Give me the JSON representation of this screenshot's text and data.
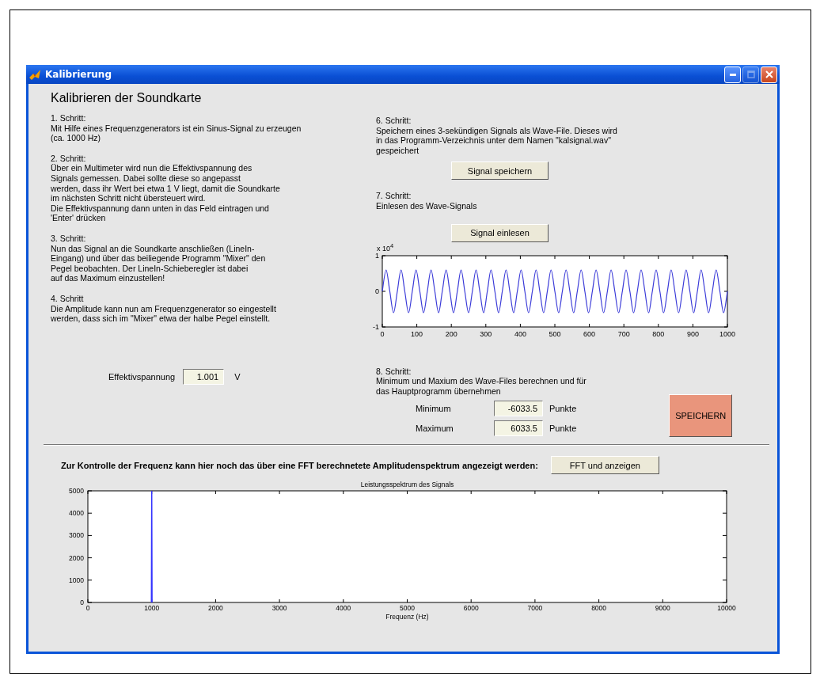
{
  "window": {
    "title": "Kalibrierung",
    "buttons": [
      {
        "kind": "minimize",
        "disabled": false
      },
      {
        "kind": "maximize",
        "disabled": true
      },
      {
        "kind": "close",
        "disabled": false
      }
    ]
  },
  "heading": "Kalibrieren der Soundkarte",
  "left_steps": [
    {
      "title": "1. Schritt:",
      "text": "Mit Hilfe eines Frequenzgenerators ist ein Sinus-Signal zu erzeugen\n(ca. 1000 Hz)"
    },
    {
      "title": "2. Schritt:",
      "text": "Über ein Multimeter wird nun die Effektivspannung des\nSignals gemessen. Dabei sollte diese so angepasst\nwerden, dass ihr Wert bei etwa 1 V liegt, damit die Soundkarte\nim nächsten Schritt nicht übersteuert wird.\nDie Effektivspannung dann unten in das Feld eintragen und\n'Enter' drücken"
    },
    {
      "title": "3. Schritt:",
      "text": "Nun das Signal an die Soundkarte anschließen (LineIn-\nEingang) und über das beiliegende Programm \"Mixer\" den\nPegel beobachten. Der LineIn-Schieberegler ist dabei\nauf das Maximum einzustellen!"
    },
    {
      "title": "4. Schritt",
      "text": "Die Amplitude kann nun am Frequenzgenerator so eingestellt\nwerden, dass sich im \"Mixer\" etwa der halbe Pegel einstellt."
    }
  ],
  "voltage": {
    "label": "Effektivspannung",
    "value": "1.001",
    "unit": "V"
  },
  "step6": {
    "title": "6. Schritt:",
    "text": "Speichern eines 3-sekündigen Signals als Wave-File. Dieses wird\nin das Programm-Verzeichnis unter dem Namen \"kalsignal.wav\"\ngespeichert",
    "button": "Signal speichern"
  },
  "step7": {
    "title": "7. Schritt:",
    "text": "Einlesen des Wave-Signals",
    "button": "Signal einlesen"
  },
  "signal_plot": {
    "exponent_label": "x 10$^{4}$",
    "chart_data": {
      "type": "line",
      "xlim": [
        0,
        1000
      ],
      "ylim": [
        -1,
        1
      ],
      "xticks": [
        0,
        100,
        200,
        300,
        400,
        500,
        600,
        700,
        800,
        900,
        1000
      ],
      "yticks": [
        -1,
        0,
        1
      ],
      "x": [
        0,
        10.9,
        21.7,
        32.6,
        43.5,
        54.3,
        65.2,
        76.1,
        87.0,
        97.8,
        108.7,
        119.6,
        130.4,
        141.3,
        152.2,
        163.0,
        173.9,
        184.8,
        195.7,
        206.5,
        217.4,
        228.3,
        239.1,
        250.0,
        260.9,
        271.7,
        282.6,
        293.5,
        304.3,
        315.2,
        326.1,
        337.0,
        347.8,
        358.7,
        369.6,
        380.4,
        391.3,
        402.2,
        413.0,
        423.9,
        434.8,
        445.7,
        456.5,
        467.4,
        478.3,
        489.1,
        500.0,
        510.9,
        521.7,
        532.6,
        543.5,
        554.3,
        565.2,
        576.1,
        587.0,
        597.8,
        608.7,
        619.6,
        630.4,
        641.3,
        652.2,
        663.0,
        673.9,
        684.8,
        695.7,
        706.5,
        717.4,
        728.3,
        739.1,
        750.0,
        760.9,
        771.7,
        782.6,
        793.5,
        804.3,
        815.2,
        826.1,
        837.0,
        847.8,
        858.7,
        869.6,
        880.4,
        891.3,
        902.2,
        913.0,
        923.9,
        934.8,
        945.7,
        956.5,
        967.4,
        978.3,
        989.1,
        1000.0
      ],
      "series": [
        {
          "color": "#3b3bd8",
          "values": [
            0,
            0.6,
            0,
            -0.6,
            0,
            0.6,
            0,
            -0.6,
            0,
            0.6,
            0,
            -0.6,
            0,
            0.6,
            0,
            -0.6,
            0,
            0.6,
            0,
            -0.6,
            0,
            0.6,
            0,
            -0.6,
            0,
            0.6,
            0,
            -0.6,
            0,
            0.6,
            0,
            -0.6,
            0,
            0.6,
            0,
            -0.6,
            0,
            0.6,
            0,
            -0.6,
            0,
            0.6,
            0,
            -0.6,
            0,
            0.6,
            0,
            -0.6,
            0,
            0.6,
            0,
            -0.6,
            0,
            0.6,
            0,
            -0.6,
            0,
            0.6,
            0,
            -0.6,
            0,
            0.6,
            0,
            -0.6,
            0,
            0.6,
            0,
            -0.6,
            0,
            0.6,
            0,
            -0.6,
            0,
            0.6,
            0,
            -0.6,
            0,
            0.6,
            0,
            -0.6,
            0,
            0.6,
            0,
            -0.6,
            0,
            0.6,
            0,
            -0.6,
            0,
            0.6,
            0,
            -0.6,
            0
          ]
        }
      ]
    }
  },
  "step8": {
    "title": "8. Schritt:",
    "text": "Minimum und Maxium des Wave-Files berechnen und für\ndas Hauptprogramm übernehmen",
    "rows": [
      {
        "label": "Minimum",
        "value": "-6033.5",
        "unit": "Punkte"
      },
      {
        "label": "Maximum",
        "value": "6033.5",
        "unit": "Punkte"
      }
    ],
    "button": "SPEICHERN"
  },
  "fft": {
    "text": "Zur Kontrolle der Frequenz kann hier noch das über eine FFT berechnetete Amplitudenspektrum angezeigt werden:",
    "button": "FFT und anzeigen",
    "chart_data": {
      "type": "line",
      "title": "Leistungsspektrum des Signals",
      "xlabel": "Frequenz (Hz)",
      "x": [
        995,
        1000,
        1005
      ],
      "series": [
        {
          "color": "#3333ff",
          "values": [
            0,
            5000,
            0
          ]
        }
      ],
      "xlim": [
        0,
        10000
      ],
      "ylim": [
        0,
        5000
      ],
      "xticks": [
        0,
        1000,
        2000,
        3000,
        4000,
        5000,
        6000,
        7000,
        8000,
        9000,
        10000
      ],
      "yticks": [
        0,
        1000,
        2000,
        3000,
        4000,
        5000
      ]
    }
  }
}
